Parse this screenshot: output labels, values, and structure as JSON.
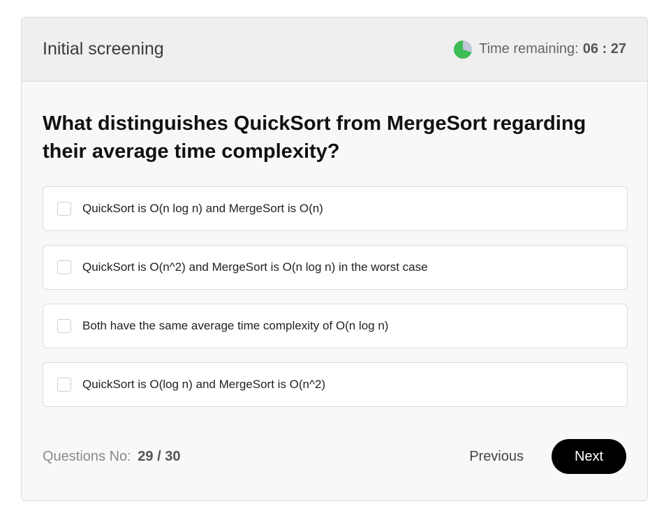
{
  "header": {
    "title": "Initial screening",
    "timer_label": "Time remaining:",
    "timer_value": "06 : 27",
    "timer_elapsed_fraction": 0.3
  },
  "question": {
    "text": "What distinguishes QuickSort from MergeSort regarding their average time complexity?",
    "options": [
      {
        "label": "QuickSort is O(n log n) and MergeSort is O(n)",
        "checked": false
      },
      {
        "label": "QuickSort is O(n^2) and MergeSort is O(n log n) in the worst case",
        "checked": false
      },
      {
        "label": "Both have the same average time complexity of O(n log n)",
        "checked": false
      },
      {
        "label": "QuickSort is O(log n) and MergeSort is O(n^2)",
        "checked": false
      }
    ]
  },
  "footer": {
    "progress_label": "Questions No:",
    "progress_value": "29 / 30",
    "previous_label": "Previous",
    "next_label": "Next"
  },
  "colors": {
    "timer_fill": "#3dbb54",
    "timer_track": "#bfc6d6",
    "accent_button": "#000000"
  },
  "icons": {
    "timer": "pie-timer-icon"
  }
}
